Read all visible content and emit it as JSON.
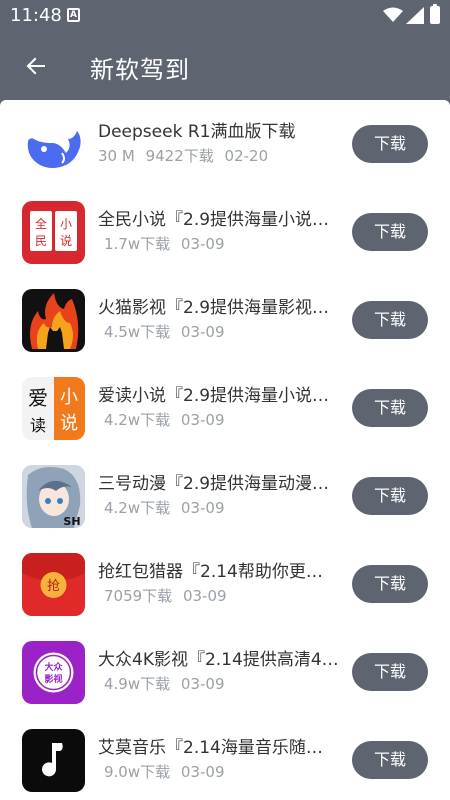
{
  "status": {
    "time": "11:48",
    "a_badge": "A"
  },
  "header": {
    "title": "新软驾到",
    "back_icon": "arrow-left-icon"
  },
  "apps": [
    {
      "name": "Deepseek R1满血版下载",
      "size": "30 M",
      "downloads": "9422下载",
      "date": "02-20",
      "button": "下载",
      "icon": "deepseek-whale-icon"
    },
    {
      "name": "全民小说『2.9提供海量小说…",
      "size": "",
      "downloads": "1.7w下载",
      "date": "03-09",
      "button": "下载",
      "icon": "quanmin-novel-icon",
      "icon_text": [
        "全",
        "民",
        "小",
        "说"
      ]
    },
    {
      "name": "火猫影视『2.9提供海量影视…",
      "size": "",
      "downloads": "4.5w下载",
      "date": "03-09",
      "button": "下载",
      "icon": "fire-cat-icon"
    },
    {
      "name": "爱读小说『2.9提供海量小说…",
      "size": "",
      "downloads": "4.2w下载",
      "date": "03-09",
      "button": "下载",
      "icon": "aidu-novel-icon",
      "icon_text": [
        "爱",
        "读",
        "小",
        "说"
      ]
    },
    {
      "name": "三号动漫『2.9提供海量动漫…",
      "size": "",
      "downloads": "4.2w下载",
      "date": "03-09",
      "button": "下载",
      "icon": "anime-girl-icon",
      "icon_text": [
        "SH"
      ]
    },
    {
      "name": "抢红包猎器『2.14帮助你更…",
      "size": "",
      "downloads": "7059下载",
      "date": "03-09",
      "button": "下载",
      "icon": "red-envelope-icon",
      "icon_text": [
        "抢"
      ]
    },
    {
      "name": "大众4K影视『2.14提供高清4…",
      "size": "",
      "downloads": "4.9w下载",
      "date": "03-09",
      "button": "下载",
      "icon": "dazhong-video-icon",
      "icon_text": [
        "大众",
        "影视"
      ]
    },
    {
      "name": "艾莫音乐『2.14海量音乐随…",
      "size": "",
      "downloads": "9.0w下载",
      "date": "03-09",
      "button": "下载",
      "icon": "music-note-icon"
    }
  ],
  "colors": {
    "primary": "#5e6470",
    "meta": "#9aa0a8",
    "text": "#333333"
  }
}
